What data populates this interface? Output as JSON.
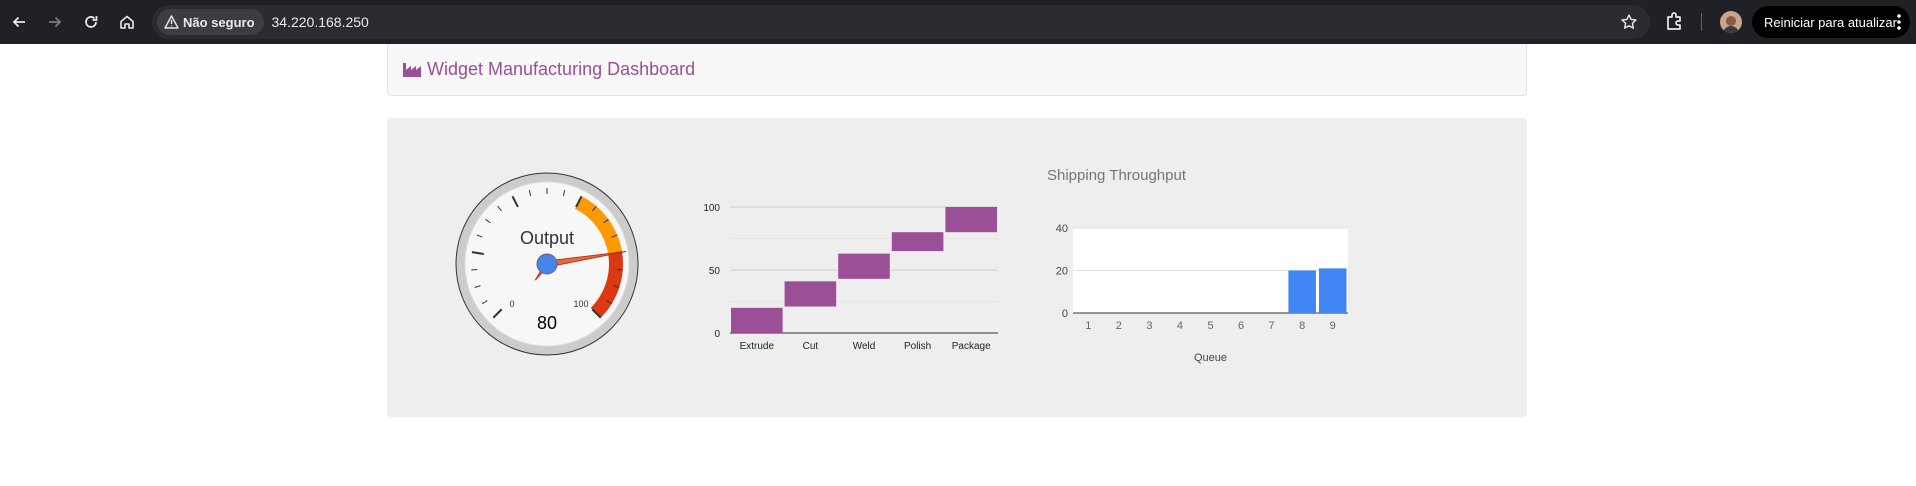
{
  "browser": {
    "security_label": "Não seguro",
    "url": "34.220.168.250",
    "update_button_label": "Reiniciar para atualizar",
    "icons": [
      "back-arrow-icon",
      "forward-arrow-icon",
      "reload-icon",
      "home-icon",
      "warning-triangle-icon",
      "star-icon",
      "extensions-icon",
      "profile-avatar",
      "more-vert-icon"
    ]
  },
  "header": {
    "title": "Widget Manufacturing Dashboard",
    "icon": "factory-icon"
  },
  "gauge": {
    "label": "Output",
    "value": 80,
    "min_label": "0",
    "max_label": "100",
    "min": 0,
    "max": 100,
    "bands": [
      {
        "from": 60,
        "to": 80,
        "color": "#ff9900"
      },
      {
        "from": 80,
        "to": 100,
        "color": "#dc3912"
      }
    ],
    "needle_color": "#dc3912"
  },
  "chart_data": [
    {
      "type": "bar",
      "subtype": "waterfall",
      "categories": [
        "Extrude",
        "Cut",
        "Weld",
        "Polish",
        "Package"
      ],
      "ranges": [
        [
          0,
          20
        ],
        [
          21,
          41
        ],
        [
          43,
          63
        ],
        [
          65,
          80
        ],
        [
          80,
          100
        ]
      ],
      "y_ticks": [
        "0",
        "50",
        "100"
      ],
      "ylim": [
        0,
        100
      ],
      "color": "#9b4f96",
      "grid": true
    },
    {
      "type": "bar",
      "title": "Shipping Throughput",
      "xlabel": "Queue",
      "categories": [
        "1",
        "2",
        "3",
        "4",
        "5",
        "6",
        "7",
        "8",
        "9"
      ],
      "values": [
        0,
        0,
        0,
        0,
        0,
        0,
        0,
        20,
        21
      ],
      "y_ticks": [
        "0",
        "20",
        "40"
      ],
      "ylim": [
        0,
        40
      ],
      "color": "#4285f4",
      "grid": true
    }
  ]
}
